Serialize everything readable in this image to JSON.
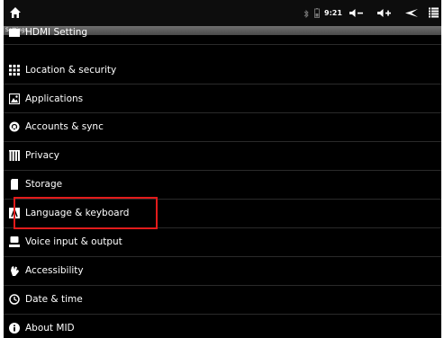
{
  "status_bar": {
    "time": "9:21",
    "icons": [
      "home-icon",
      "bluetooth-icon",
      "battery-icon",
      "volume-down-icon",
      "volume-up-icon",
      "back-icon",
      "menu-icon"
    ]
  },
  "title_bar": {
    "title": "Settings"
  },
  "settings_list": {
    "items": [
      {
        "label": "HDMI Setting",
        "icon": "hdmi-icon"
      },
      {
        "label": "Location & security",
        "icon": "location-security-icon"
      },
      {
        "label": "Applications",
        "icon": "applications-icon"
      },
      {
        "label": "Accounts & sync",
        "icon": "accounts-sync-icon"
      },
      {
        "label": "Privacy",
        "icon": "privacy-icon"
      },
      {
        "label": "Storage",
        "icon": "storage-icon"
      },
      {
        "label": "Language & keyboard",
        "icon": "language-keyboard-icon"
      },
      {
        "label": "Voice input & output",
        "icon": "voice-icon"
      },
      {
        "label": "Accessibility",
        "icon": "accessibility-icon"
      },
      {
        "label": "Date & time",
        "icon": "clock-icon"
      },
      {
        "label": "About MID",
        "icon": "info-icon"
      }
    ]
  },
  "annotation": {
    "highlight_color": "#e21b1b",
    "highlighted_item": "Language & keyboard"
  }
}
